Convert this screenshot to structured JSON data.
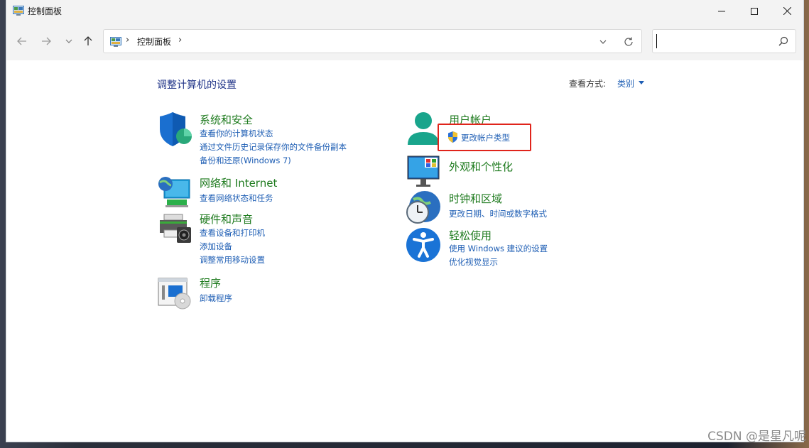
{
  "window": {
    "title": "控制面板"
  },
  "address": {
    "crumb": "控制面板",
    "sep": "›"
  },
  "search": {
    "placeholder": "",
    "value": ""
  },
  "page": {
    "title": "调整计算机的设置",
    "viewby_label": "查看方式:",
    "viewby_value": "类别"
  },
  "categories": {
    "system": {
      "title": "系统和安全",
      "links": [
        "查看你的计算机状态",
        "通过文件历史记录保存你的文件备份副本",
        "备份和还原(Windows 7)"
      ]
    },
    "network": {
      "title": "网络和 Internet",
      "links": [
        "查看网络状态和任务"
      ]
    },
    "hardware": {
      "title": "硬件和声音",
      "links": [
        "查看设备和打印机",
        "添加设备",
        "调整常用移动设置"
      ]
    },
    "programs": {
      "title": "程序",
      "links": [
        "卸载程序"
      ]
    },
    "users": {
      "title": "用户帐户",
      "links": [
        "更改帐户类型"
      ]
    },
    "appearance": {
      "title": "外观和个性化",
      "links": []
    },
    "clock": {
      "title": "时钟和区域",
      "links": [
        "更改日期、时间或数字格式"
      ]
    },
    "ease": {
      "title": "轻松使用",
      "links": [
        "使用 Windows 建议的设置",
        "优化视觉显示"
      ]
    }
  },
  "watermark": "CSDN @是星凡呢",
  "colors": {
    "category_title": "#1d7a1d",
    "link": "#1e5eb4",
    "page_title": "#1e3287",
    "highlight": "#e0241b"
  }
}
